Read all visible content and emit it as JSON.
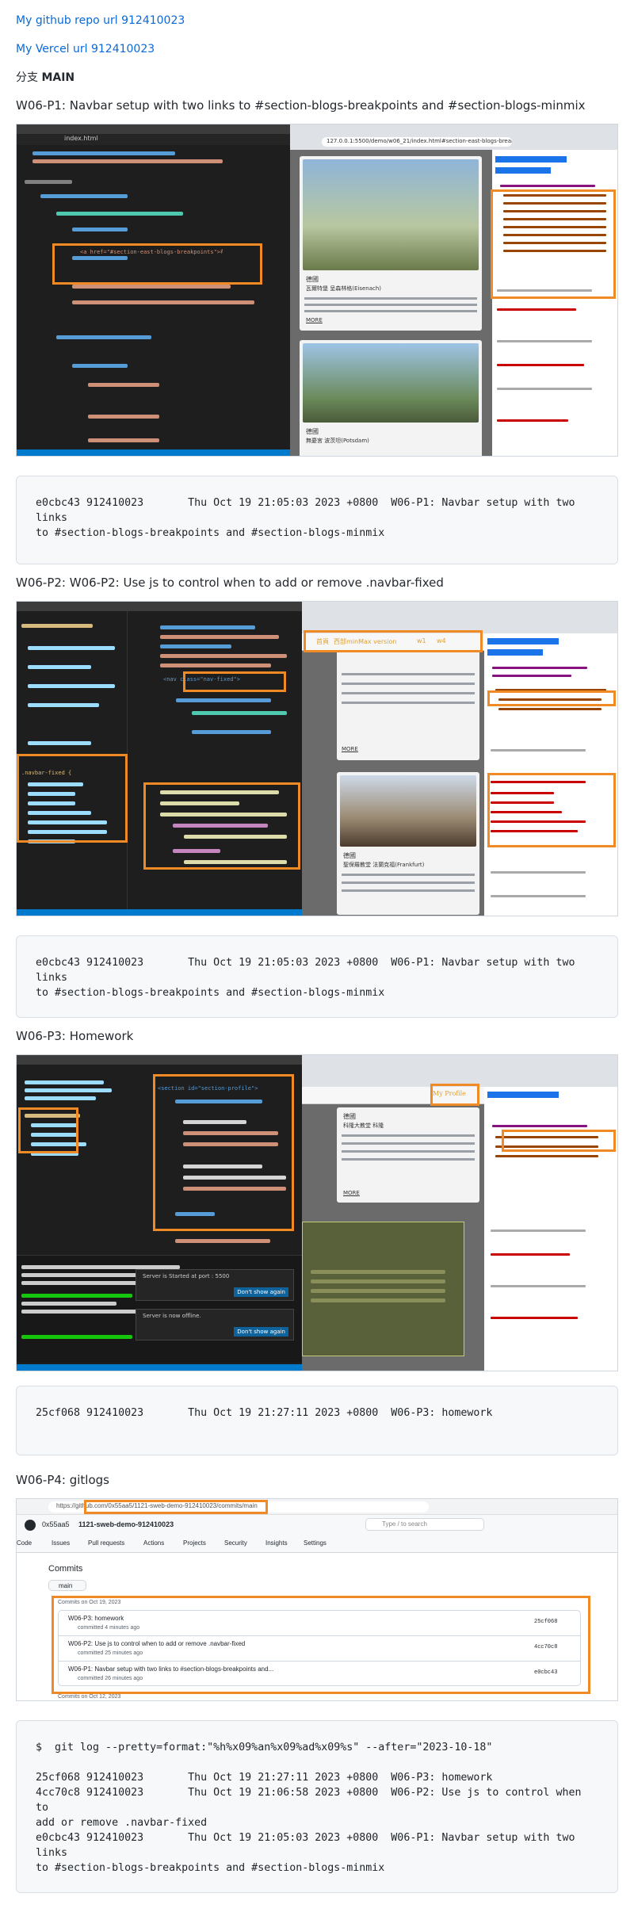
{
  "links": {
    "repo": "My github repo url 912410023",
    "vercel": "My Vercel url 912410023"
  },
  "branch": {
    "prefix": "分支",
    "name": "MAIN"
  },
  "sections": [
    {
      "title": "W06-P1: Navbar setup with two links to #section-blogs-breakpoints and #section-blogs-minmix",
      "code": "e0cbc43 912410023       Thu Oct 19 21:05:03 2023 +0800  W06-P1: Navbar setup with two links\nto #section-blogs-breakpoints and #section-blogs-minmix"
    },
    {
      "title": "W06-P2: W06-P2: Use js to control when to add or remove .navbar-fixed",
      "code": "e0cbc43 912410023       Thu Oct 19 21:05:03 2023 +0800  W06-P1: Navbar setup with two links\nto #section-blogs-breakpoints and #section-blogs-minmix"
    },
    {
      "title": "W06-P3: Homework",
      "code": "25cf068 912410023       Thu Oct 19 21:27:11 2023 +0800  W06-P3: homework"
    },
    {
      "title": "W06-P4: gitlogs",
      "code": "$  git log --pretty=format:\"%h%x09%an%x09%ad%x09%s\" --after=\"2023-10-18\"\n\n25cf068 912410023       Thu Oct 19 21:27:11 2023 +0800  W06-P3: homework\n4cc70c8 912410023       Thu Oct 19 21:06:58 2023 +0800  W06-P2: Use js to control when to\nadd or remove .navbar-fixed\ne0cbc43 912410023       Thu Oct 19 21:05:03 2023 +0800  W06-P1: Navbar setup with two links\nto #section-blogs-breakpoints and #section-blogs-minmix"
    }
  ],
  "shot1": {
    "tab": "index.html",
    "address": "127.0.0.1:5500/demo/w06_21/index.html#section-east-blogs-breakpoints",
    "code_a": "<a href=\"#section-east-blogs-breakpoints\">布局</a>",
    "code_b": "<a href=\"#section-west-blogs-breakpoints\">西部</a>",
    "card1_title": "德國",
    "card1_sub": "瓦爾特堡 呈森林格(Eisenach)",
    "card2_title": "德國",
    "card2_sub": "無憂宮 波茨坦(Potsdam)",
    "more": "MORE"
  },
  "shot2": {
    "nav_items": [
      "首頁",
      "西部minMax version",
      "w1",
      "w4"
    ],
    "code_class": "<nav class=\"nav-fixed\">",
    "css_rule": ".navbar-fixed {",
    "card1_title": "德國",
    "card2_title": "德國",
    "card2_sub": "聖保羅教堂 法蘭克福(Frankfurt)",
    "more": "MORE"
  },
  "shot3": {
    "nav_active": "My Profile",
    "section_tag": "<section id=\"section-profile\">",
    "card_title": "德國",
    "card_sub": "科隆大教堂 科隆",
    "more": "MORE",
    "popup1": "Server is Started at port : 5500",
    "popup2": "Server is now offline.",
    "popup_btn": "Don't show again"
  },
  "shot4": {
    "url": "https://github.com/0x55aa5/1121-sweb-demo-912410023/commits/main",
    "repo": "1121-sweb-demo-912410023",
    "owner": "0x55aa5",
    "search": "Type / to search",
    "tabs": [
      "Code",
      "Issues",
      "Pull requests",
      "Actions",
      "Projects",
      "Security",
      "Insights",
      "Settings"
    ],
    "heading": "Commits",
    "branch": "main",
    "group1": "Commits on Oct 19, 2023",
    "group2": "Commits on Oct 12, 2023",
    "commits": [
      {
        "msg": "W06-P3: homework",
        "meta": "committed 4 minutes ago",
        "sha": "25cf068"
      },
      {
        "msg": "W06-P2: Use js to control when to add or remove .navbar-fixed",
        "meta": "committed 25 minutes ago",
        "sha": "4cc70c8"
      },
      {
        "msg": "W06-P1: Navbar setup with two links to #section-blogs-breakpoints and...",
        "meta": "committed 26 minutes ago",
        "sha": "e0cbc43"
      }
    ]
  }
}
